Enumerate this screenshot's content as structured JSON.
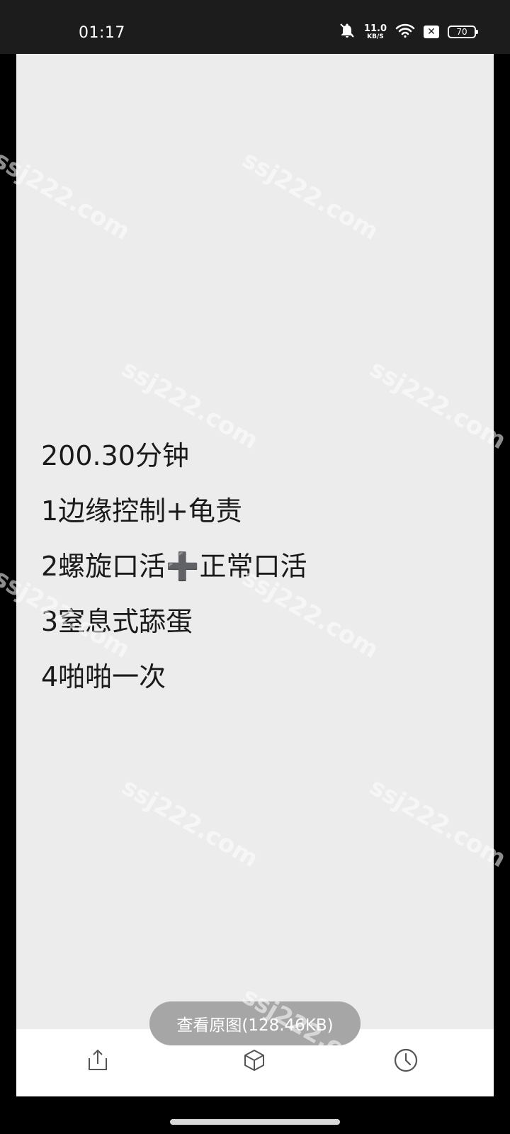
{
  "status_bar": {
    "time": "01:17",
    "net_speed_value": "11.0",
    "net_speed_unit": "KB/S",
    "battery_level": "70",
    "icons": [
      "bell-off-icon",
      "wifi-icon",
      "sim-disabled-icon",
      "battery-icon"
    ]
  },
  "content": {
    "lines": [
      "200.30分钟",
      "1边缘控制+龟责",
      "2螺旋口活➕正常口活",
      "3窒息式舔蛋",
      "4啪啪一次"
    ]
  },
  "view_original_button": "查看原图(128.46KB)",
  "toolbar": {
    "icons": [
      "share-icon",
      "cube-icon",
      "clock-icon"
    ]
  },
  "watermark_text": "ssj222.com",
  "colors": {
    "status_bar_bg": "#1c1c1c",
    "viewer_bg": "#ececec",
    "text": "#1a1a1a",
    "button_bg": "#a6a6a6"
  }
}
